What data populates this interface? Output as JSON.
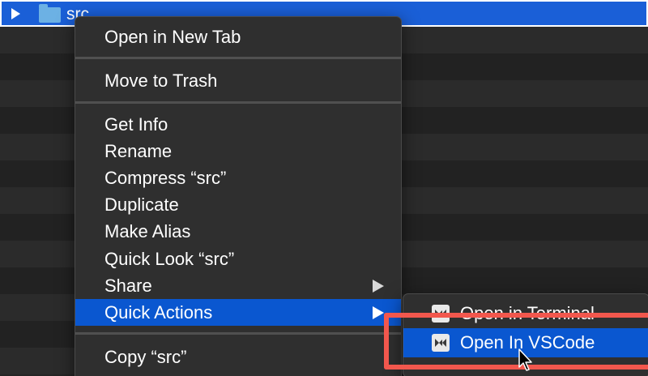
{
  "file_row": {
    "name": "src",
    "disclosure_icon": "disclosure-triangle-icon",
    "folder_icon": "folder-icon"
  },
  "context_menu": {
    "items": [
      {
        "label": "Open in New Tab"
      },
      {
        "label": "Move to Trash"
      },
      {
        "label": "Get Info"
      },
      {
        "label": "Rename"
      },
      {
        "label": "Compress “src”"
      },
      {
        "label": "Duplicate"
      },
      {
        "label": "Make Alias"
      },
      {
        "label": "Quick Look “src”"
      },
      {
        "label": "Share",
        "has_submenu": true
      },
      {
        "label": "Quick Actions",
        "has_submenu": true,
        "highlighted": true
      },
      {
        "label": "Copy “src”"
      }
    ]
  },
  "quick_actions_submenu": {
    "items": [
      {
        "label": "Open in Terminal",
        "icon": "automator-workflow-icon"
      },
      {
        "label": "Open In VSCode",
        "icon": "automator-workflow-icon",
        "highlighted": true
      }
    ]
  },
  "colors": {
    "selection_blue": "#0a57d0",
    "annotation_red": "#f2574d",
    "menu_background": "#2f2f2f"
  }
}
